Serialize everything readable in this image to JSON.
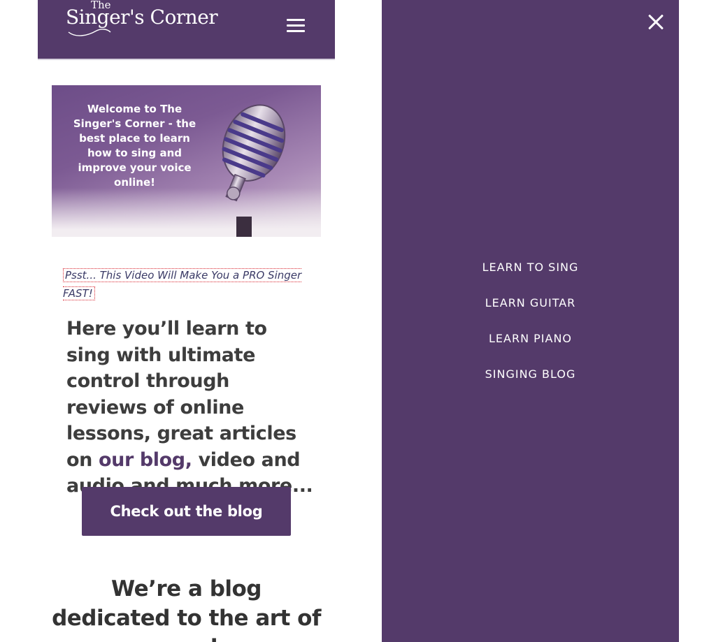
{
  "header": {
    "logo_top": "The",
    "logo_name": "Singer's Corner",
    "menu_icon": "hamburger-icon",
    "brand_color": "#543a6a"
  },
  "hero": {
    "text": "Welcome to The Singer's Corner - the best place to learn how to sing and improve your voice online!",
    "image_icon": "microphone-image"
  },
  "promo": {
    "link_text": "Psst... This Video Will Make You a PRO Singer FAST!"
  },
  "intro": {
    "before_link": "Here you’ll learn to sing with ultimate control through reviews of online lessons, great articles on ",
    "link_text": "our blog,",
    "after_link": " video and audio and much more..."
  },
  "cta": {
    "label": "Check out the blog"
  },
  "section": {
    "heading": "We’re a blog dedicated to the art of vocal"
  },
  "menu": {
    "close_icon": "close-icon",
    "items": [
      {
        "label": "LEARN TO SING"
      },
      {
        "label": "LEARN GUITAR"
      },
      {
        "label": "LEARN PIANO"
      },
      {
        "label": "SINGING BLOG"
      }
    ]
  }
}
